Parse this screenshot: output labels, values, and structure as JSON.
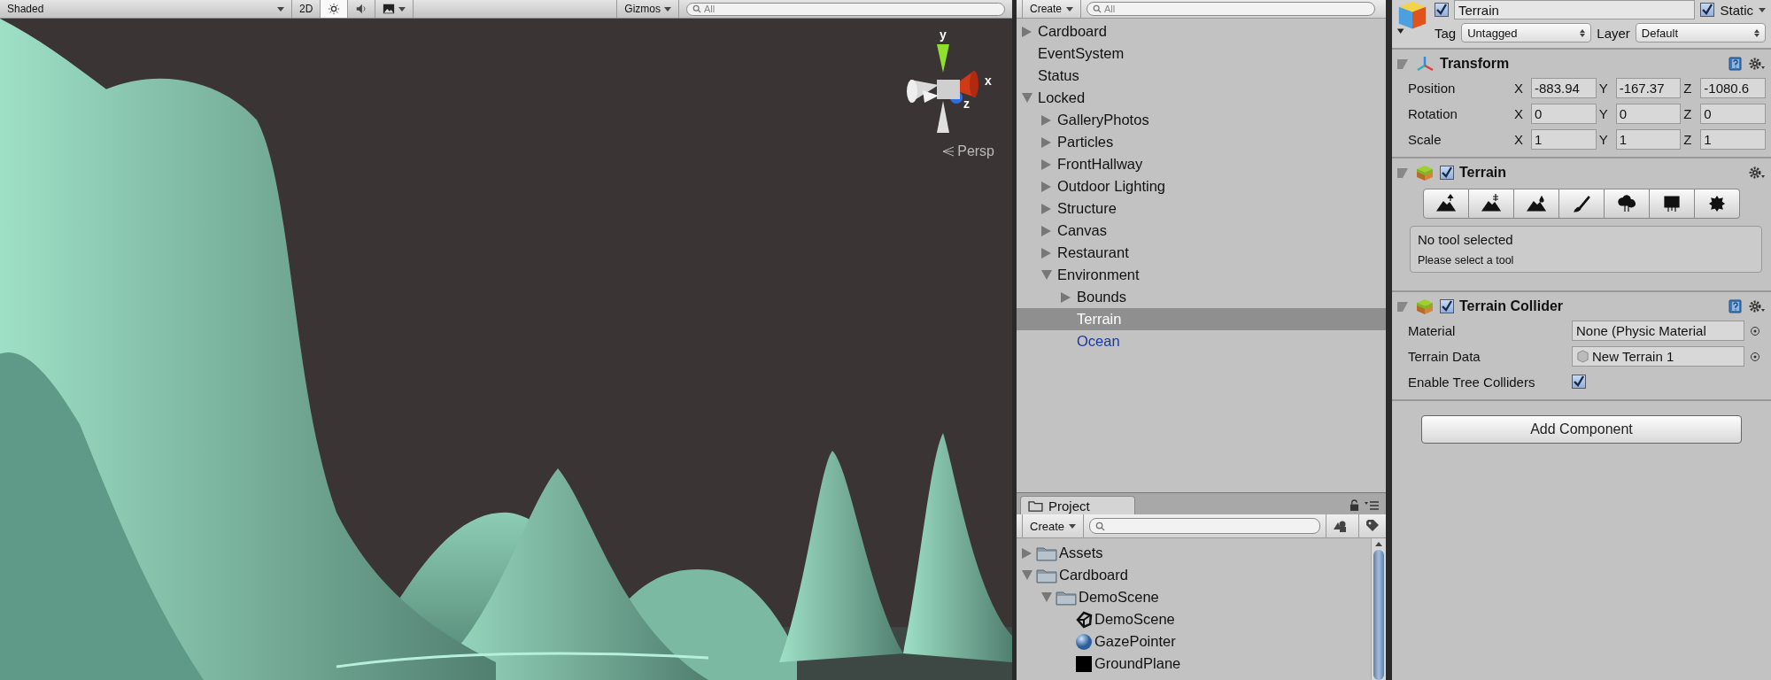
{
  "scene_view": {
    "toolbar": {
      "shading_mode": "Shaded",
      "mode_2d": "2D",
      "lighting_on": true,
      "gizmos": "Gizmos",
      "search_placeholder": "All"
    },
    "gizmo": {
      "y_label": "y",
      "x_label": "x",
      "z_label": "z",
      "projection": "Persp"
    }
  },
  "hierarchy": {
    "create": "Create",
    "search_placeholder": "All",
    "items": [
      {
        "label": "Cardboard",
        "selected": false,
        "expanded": false
      },
      {
        "label": "EventSystem",
        "selected": false
      },
      {
        "label": "Status",
        "selected": false
      },
      {
        "label": "Locked",
        "selected": false,
        "expanded": true,
        "children": [
          {
            "label": "GalleryPhotos",
            "selected": false,
            "expanded": false
          },
          {
            "label": "Particles",
            "selected": false,
            "expanded": false
          },
          {
            "label": "FrontHallway",
            "selected": false,
            "expanded": false
          },
          {
            "label": "Outdoor Lighting",
            "selected": false,
            "expanded": false
          },
          {
            "label": "Structure",
            "selected": false,
            "expanded": false
          },
          {
            "label": "Canvas",
            "selected": false,
            "expanded": false
          },
          {
            "label": "Restaurant",
            "selected": false,
            "expanded": false
          },
          {
            "label": "Environment",
            "selected": false,
            "expanded": true,
            "children": [
              {
                "label": "Bounds",
                "selected": false,
                "expanded": false
              },
              {
                "label": "Terrain",
                "selected": true
              },
              {
                "label": "Ocean",
                "prefab": true,
                "selected": false
              }
            ]
          }
        ]
      }
    ]
  },
  "project": {
    "tab": "Project",
    "create": "Create",
    "items": [
      {
        "label": "Assets",
        "kind": "folder",
        "expanded": false
      },
      {
        "label": "Cardboard",
        "kind": "folder",
        "expanded": true,
        "children": [
          {
            "label": "DemoScene",
            "kind": "folder",
            "expanded": true,
            "children": [
              {
                "label": "DemoScene",
                "kind": "scene"
              },
              {
                "label": "GazePointer",
                "kind": "material"
              },
              {
                "label": "GroundPlane",
                "kind": "mesh"
              }
            ]
          }
        ]
      }
    ]
  },
  "inspector": {
    "object": {
      "active": true,
      "name": "Terrain",
      "static": true,
      "static_label": "Static",
      "tag_label": "Tag",
      "tag": "Untagged",
      "layer_label": "Layer",
      "layer": "Default"
    },
    "transform": {
      "title": "Transform",
      "expanded": true,
      "rows": [
        {
          "label": "Position",
          "fields": [
            {
              "axis": "X",
              "value": "-883.94"
            },
            {
              "axis": "Y",
              "value": "-167.37"
            },
            {
              "axis": "Z",
              "value": "-1080.6"
            }
          ]
        },
        {
          "label": "Rotation",
          "fields": [
            {
              "axis": "X",
              "value": "0"
            },
            {
              "axis": "Y",
              "value": "0"
            },
            {
              "axis": "Z",
              "value": "0"
            }
          ]
        },
        {
          "label": "Scale",
          "fields": [
            {
              "axis": "X",
              "value": "1"
            },
            {
              "axis": "Y",
              "value": "1"
            },
            {
              "axis": "Z",
              "value": "1"
            }
          ]
        }
      ]
    },
    "terrain": {
      "title": "Terrain",
      "expanded": true,
      "enabled": true,
      "info_title": "No tool selected",
      "info_text": "Please select a tool"
    },
    "terrain_collider": {
      "title": "Terrain Collider",
      "expanded": true,
      "enabled": true,
      "material_label": "Material",
      "material": "None (Physic Material",
      "terrain_data_label": "Terrain Data",
      "terrain_data": "New Terrain 1",
      "tree_colliders_label": "Enable Tree Colliders",
      "tree_colliders": true
    },
    "add_component": "Add Component"
  }
}
